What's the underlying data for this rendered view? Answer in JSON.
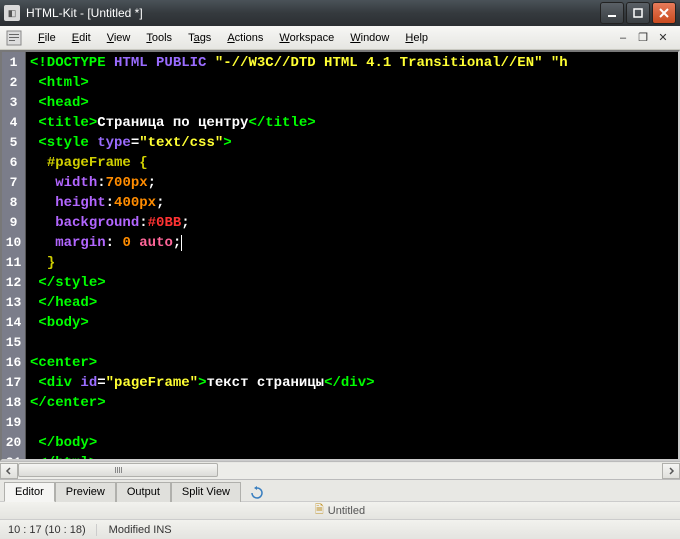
{
  "titlebar": {
    "title": "HTML-Kit - [Untitled *]"
  },
  "menubar": {
    "items": [
      {
        "label": "File",
        "accel": "F"
      },
      {
        "label": "Edit",
        "accel": "E"
      },
      {
        "label": "View",
        "accel": "V"
      },
      {
        "label": "Tools",
        "accel": "T"
      },
      {
        "label": "Tags",
        "accel": "a"
      },
      {
        "label": "Actions",
        "accel": "A"
      },
      {
        "label": "Workspace",
        "accel": "W"
      },
      {
        "label": "Window",
        "accel": "W"
      },
      {
        "label": "Help",
        "accel": "H"
      }
    ]
  },
  "code": {
    "lines": [
      [
        [
          "tk-tag",
          "<!DOCTYPE "
        ],
        [
          "tk-attr",
          "HTML PUBLIC "
        ],
        [
          "tk-val",
          "\"-//W3C//DTD HTML 4.1 Transitional//EN\" \"h"
        ]
      ],
      [
        [
          "tk-text",
          " "
        ],
        [
          "tk-tag",
          "<html>"
        ]
      ],
      [
        [
          "tk-text",
          " "
        ],
        [
          "tk-tag",
          "<head>"
        ]
      ],
      [
        [
          "tk-text",
          " "
        ],
        [
          "tk-tag",
          "<title>"
        ],
        [
          "tk-text",
          "Страница по центру"
        ],
        [
          "tk-tag",
          "</title>"
        ]
      ],
      [
        [
          "tk-text",
          " "
        ],
        [
          "tk-tag",
          "<style "
        ],
        [
          "tk-attr",
          "type"
        ],
        [
          "tk-text",
          "="
        ],
        [
          "tk-val",
          "\"text/css\""
        ],
        [
          "tk-tag",
          ">"
        ]
      ],
      [
        [
          "tk-text",
          "  "
        ],
        [
          "tk-sel",
          "#pageFrame {"
        ]
      ],
      [
        [
          "tk-text",
          "   "
        ],
        [
          "tk-prop",
          "width"
        ],
        [
          "tk-text",
          ":"
        ],
        [
          "tk-num",
          "700px"
        ],
        [
          "tk-text",
          ";"
        ]
      ],
      [
        [
          "tk-text",
          "   "
        ],
        [
          "tk-prop",
          "height"
        ],
        [
          "tk-text",
          ":"
        ],
        [
          "tk-num",
          "400px"
        ],
        [
          "tk-text",
          ";"
        ]
      ],
      [
        [
          "tk-text",
          "   "
        ],
        [
          "tk-prop",
          "background"
        ],
        [
          "tk-text",
          ":"
        ],
        [
          "tk-hex",
          "#0BB"
        ],
        [
          "tk-text",
          ";"
        ]
      ],
      [
        [
          "tk-text",
          "   "
        ],
        [
          "tk-prop",
          "margin"
        ],
        [
          "tk-text",
          ": "
        ],
        [
          "tk-num",
          "0"
        ],
        [
          "tk-text",
          " "
        ],
        [
          "tk-kw",
          "auto"
        ],
        [
          "tk-text",
          ";"
        ],
        [
          "cursor",
          ""
        ]
      ],
      [
        [
          "tk-text",
          "  "
        ],
        [
          "tk-sel",
          "}"
        ]
      ],
      [
        [
          "tk-text",
          " "
        ],
        [
          "tk-tag",
          "</style>"
        ]
      ],
      [
        [
          "tk-text",
          " "
        ],
        [
          "tk-tag",
          "</head>"
        ]
      ],
      [
        [
          "tk-text",
          " "
        ],
        [
          "tk-tag",
          "<body>"
        ]
      ],
      [],
      [
        [
          "tk-tag",
          "<center>"
        ]
      ],
      [
        [
          "tk-text",
          " "
        ],
        [
          "tk-tag",
          "<div "
        ],
        [
          "tk-attr",
          "id"
        ],
        [
          "tk-text",
          "="
        ],
        [
          "tk-val",
          "\"pageFrame\""
        ],
        [
          "tk-tag",
          ">"
        ],
        [
          "tk-text",
          "текст страницы"
        ],
        [
          "tk-tag",
          "</div>"
        ]
      ],
      [
        [
          "tk-tag",
          "</center>"
        ]
      ],
      [],
      [
        [
          "tk-text",
          " "
        ],
        [
          "tk-tag",
          "</body>"
        ]
      ],
      [
        [
          "tk-text",
          " "
        ],
        [
          "tk-tag",
          "</html>"
        ]
      ]
    ]
  },
  "tabs": {
    "items": [
      "Editor",
      "Preview",
      "Output",
      "Split View"
    ],
    "active": 0
  },
  "docTab": {
    "label": "Untitled"
  },
  "status": {
    "pos": "10 : 17 (10 : 18)",
    "mode": "Modified INS"
  }
}
